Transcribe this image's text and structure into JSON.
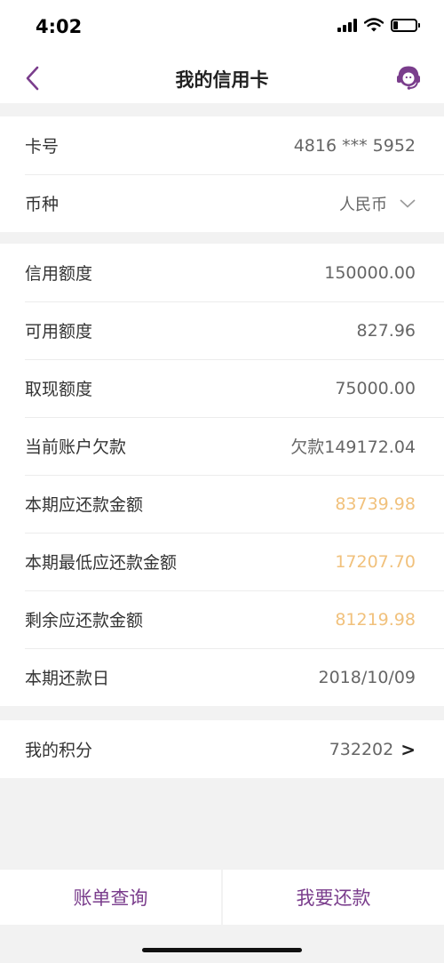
{
  "status_bar": {
    "time": "4:02"
  },
  "nav": {
    "title": "我的信用卡"
  },
  "card_info": {
    "card_number_label": "卡号",
    "card_number_value": "4816 *** 5952",
    "currency_label": "币种",
    "currency_value": "人民币"
  },
  "details": [
    {
      "label": "信用额度",
      "value": "150000.00"
    },
    {
      "label": "可用额度",
      "value": "827.96"
    },
    {
      "label": "取现额度",
      "value": "75000.00"
    },
    {
      "label": "当前账户欠款",
      "value": "欠款149172.04"
    },
    {
      "label": "本期应还款金额",
      "value": "83739.98"
    },
    {
      "label": "本期最低应还款金额",
      "value": "17207.70"
    },
    {
      "label": "剩余应还款金额",
      "value": "81219.98"
    },
    {
      "label": "本期还款日",
      "value": "2018/10/09"
    }
  ],
  "points": {
    "label": "我的积分",
    "value": "732202",
    "arrow": ">"
  },
  "bottom": {
    "bill_query": "账单查询",
    "repay": "我要还款"
  },
  "colors": {
    "brand": "#7a3d8c",
    "accent_amount": "#f1c17c"
  }
}
